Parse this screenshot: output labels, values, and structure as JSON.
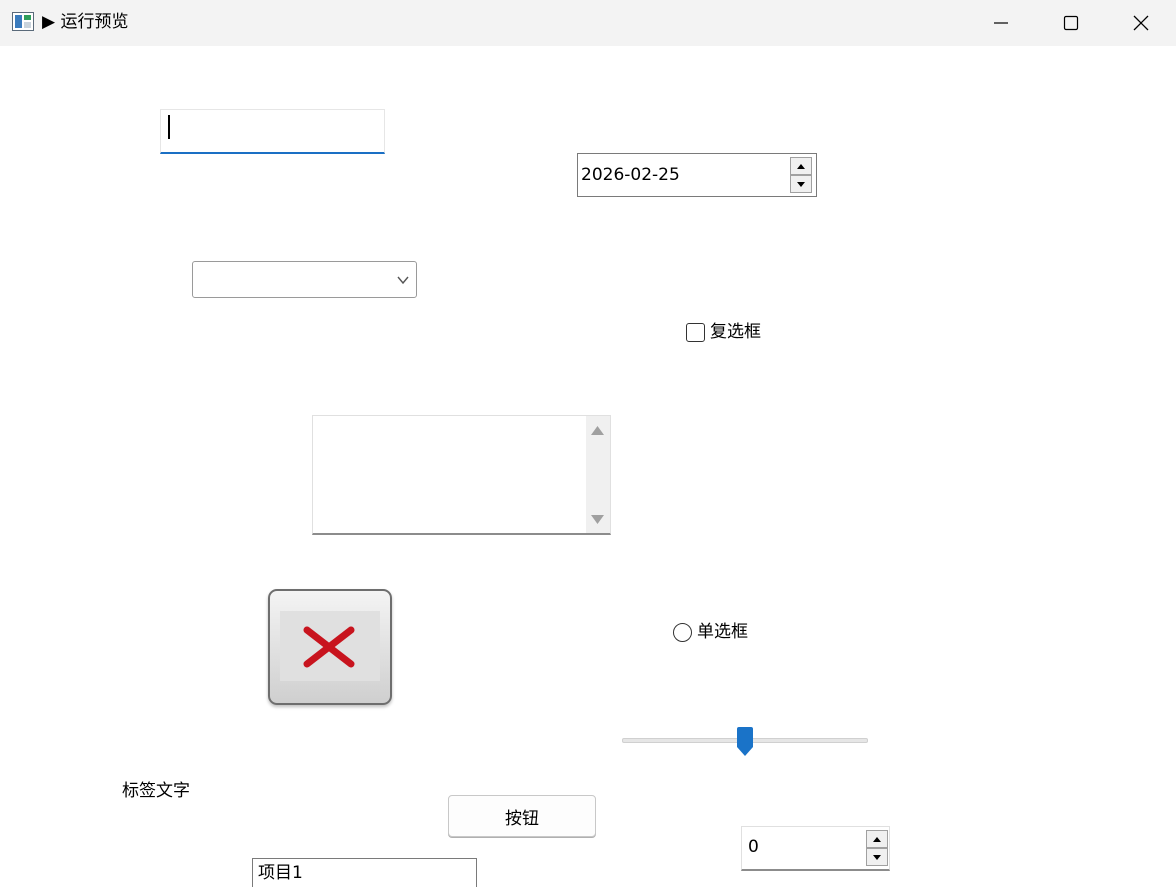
{
  "window": {
    "title": "▶ 运行预览",
    "minimize_label": "",
    "maximize_label": "",
    "close_label": ""
  },
  "controls": {
    "textbox": {
      "value": "",
      "placeholder": ""
    },
    "datepicker": {
      "value": "2026-02-25"
    },
    "combobox": {
      "selected": ""
    },
    "checkbox": {
      "label": "复选框",
      "checked": false
    },
    "radio": {
      "label": "单选框",
      "checked": false
    },
    "slider": {
      "value_fraction": 0.5
    },
    "label": {
      "text": "标签文字"
    },
    "button": {
      "label": "按钮"
    },
    "numeric": {
      "value": "0"
    },
    "list": {
      "items": [
        "项目1"
      ]
    }
  },
  "icons": {
    "picture": "red-x-icon",
    "window_app": "app-window-icon"
  },
  "colors": {
    "accent": "#1a6fc4",
    "slider_thumb": "#1a73c8",
    "error_x": "#c8141e",
    "titlebar_bg": "#f3f3f3"
  }
}
